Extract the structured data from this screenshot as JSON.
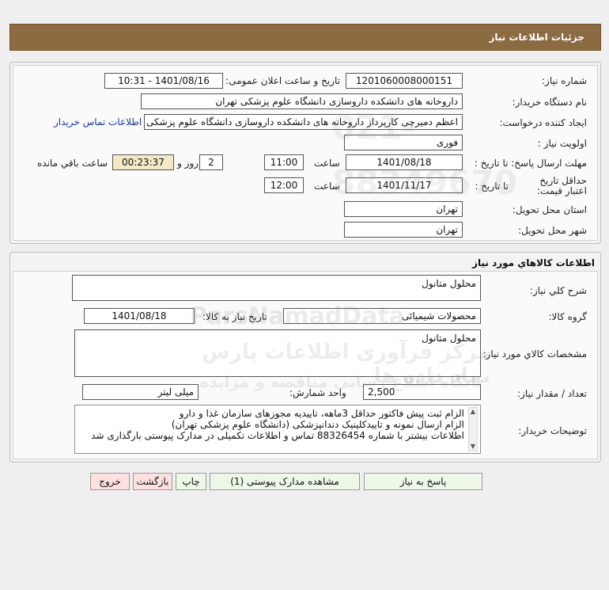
{
  "header": {
    "title": "جزئیات اطلاعات نیاز"
  },
  "details": {
    "need_number_label": "شماره نیاز:",
    "need_number": "1201060008000151",
    "announce_label": "تاریخ و ساعت اعلان عمومی:",
    "announce_value": "1401/08/16 - 10:31",
    "buyer_org_label": "نام دستگاه خریدار:",
    "buyer_org": "داروخانه های دانشکده داروسازی دانشگاه علوم پزشکی تهران",
    "creator_label": "ایجاد کننده درخواست:",
    "creator": "اعظم دمیرچی کارپرداز داروخانه های دانشکده داروسازی دانشگاه علوم پزشکی ت",
    "contact_link": "اطلاعات تماس خریدار",
    "priority_label": "اولویت نیاز :",
    "priority": "فوری",
    "deadline_label": "مهلت ارسال پاسخ:  تا تاریخ :",
    "deadline_date": "1401/08/18",
    "time_label": "ساعت",
    "deadline_time": "11:00",
    "days_value": "2",
    "days_label": "روز و",
    "remaining_time": "00:23:37",
    "remaining_label": "ساعت باقي مانده",
    "validity_label": "حداقل تاریخ اعتبار قیمت:",
    "validity_to_label": "تا تاریخ :",
    "validity_date": "1401/11/17",
    "validity_time_label": "ساعت",
    "validity_time": "12:00",
    "province_label": "استان محل تحویل:",
    "province": "تهران",
    "city_label": "شهر محل تحویل:",
    "city": "تهران"
  },
  "goods": {
    "section_title": "اطلاعات کالاهاي مورد نياز",
    "summary_label": "شرح کلي نياز:",
    "summary": "محلول متانول",
    "group_label": "گروه کالا:",
    "group": "محصولات شیمیائی",
    "need_date_label": "تاریخ نیاز به کالا:",
    "need_date": "1401/08/18",
    "specs_label": "مشخصات کالاي مورد نياز:",
    "specs": "محلول متانول",
    "qty_label": "تعداد / مقدار نیاز:",
    "qty": "2,500",
    "unit_label": "واحد شمارش:",
    "unit": "میلی لیتر",
    "notes_label": "توضیحات خریدار:",
    "notes": [
      "الزام ثبت پیش فاکتور حداقل 3ماهه، تاییدیه مجوزهای سازمان غذا و دارو",
      "الزام ارسال نمونه و تاییدکلینیک دندانپزشکی (دانشگاه علوم پزشکی تهران)",
      "اطلاعات بیشتر با شماره 88326454 تماس و اطلاعات تکمیلی در مدارک پیوستی بارگذاری شد"
    ]
  },
  "buttons": {
    "reply": "پاسخ به نیاز",
    "attachments": "مشاهده مدارک پیوستی (1)",
    "print": "چاپ",
    "back": "بازگشت",
    "exit": "خروج"
  },
  "watermark": {
    "brand": "ParsNamadData",
    "line1": "مرکز فرآوری اطلاعات پارس نماد داده ها",
    "line2": "پایگاه اطلاع رسانی مناقصه و مزایده",
    "number": "021-88349670"
  },
  "colors": {
    "header_bg": "#8c6a42",
    "highlight_bg": "#f2eac6",
    "button_green": "#eef8e8",
    "button_red": "#fde0e0",
    "link": "#1a3a9c"
  }
}
